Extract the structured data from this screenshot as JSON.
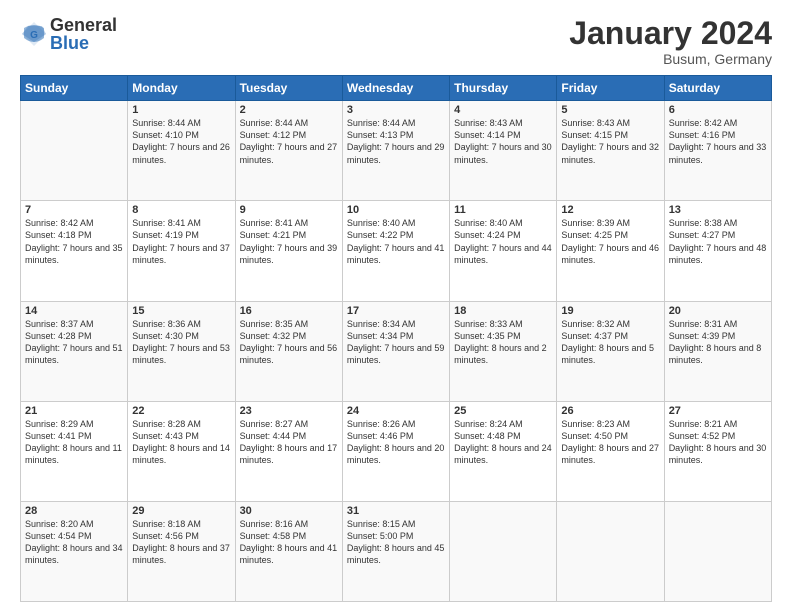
{
  "logo": {
    "general": "General",
    "blue": "Blue"
  },
  "header": {
    "month": "January 2024",
    "location": "Busum, Germany"
  },
  "weekdays": [
    "Sunday",
    "Monday",
    "Tuesday",
    "Wednesday",
    "Thursday",
    "Friday",
    "Saturday"
  ],
  "weeks": [
    [
      {
        "day": "",
        "sunrise": "",
        "sunset": "",
        "daylight": ""
      },
      {
        "day": "1",
        "sunrise": "Sunrise: 8:44 AM",
        "sunset": "Sunset: 4:10 PM",
        "daylight": "Daylight: 7 hours and 26 minutes."
      },
      {
        "day": "2",
        "sunrise": "Sunrise: 8:44 AM",
        "sunset": "Sunset: 4:12 PM",
        "daylight": "Daylight: 7 hours and 27 minutes."
      },
      {
        "day": "3",
        "sunrise": "Sunrise: 8:44 AM",
        "sunset": "Sunset: 4:13 PM",
        "daylight": "Daylight: 7 hours and 29 minutes."
      },
      {
        "day": "4",
        "sunrise": "Sunrise: 8:43 AM",
        "sunset": "Sunset: 4:14 PM",
        "daylight": "Daylight: 7 hours and 30 minutes."
      },
      {
        "day": "5",
        "sunrise": "Sunrise: 8:43 AM",
        "sunset": "Sunset: 4:15 PM",
        "daylight": "Daylight: 7 hours and 32 minutes."
      },
      {
        "day": "6",
        "sunrise": "Sunrise: 8:42 AM",
        "sunset": "Sunset: 4:16 PM",
        "daylight": "Daylight: 7 hours and 33 minutes."
      }
    ],
    [
      {
        "day": "7",
        "sunrise": "Sunrise: 8:42 AM",
        "sunset": "Sunset: 4:18 PM",
        "daylight": "Daylight: 7 hours and 35 minutes."
      },
      {
        "day": "8",
        "sunrise": "Sunrise: 8:41 AM",
        "sunset": "Sunset: 4:19 PM",
        "daylight": "Daylight: 7 hours and 37 minutes."
      },
      {
        "day": "9",
        "sunrise": "Sunrise: 8:41 AM",
        "sunset": "Sunset: 4:21 PM",
        "daylight": "Daylight: 7 hours and 39 minutes."
      },
      {
        "day": "10",
        "sunrise": "Sunrise: 8:40 AM",
        "sunset": "Sunset: 4:22 PM",
        "daylight": "Daylight: 7 hours and 41 minutes."
      },
      {
        "day": "11",
        "sunrise": "Sunrise: 8:40 AM",
        "sunset": "Sunset: 4:24 PM",
        "daylight": "Daylight: 7 hours and 44 minutes."
      },
      {
        "day": "12",
        "sunrise": "Sunrise: 8:39 AM",
        "sunset": "Sunset: 4:25 PM",
        "daylight": "Daylight: 7 hours and 46 minutes."
      },
      {
        "day": "13",
        "sunrise": "Sunrise: 8:38 AM",
        "sunset": "Sunset: 4:27 PM",
        "daylight": "Daylight: 7 hours and 48 minutes."
      }
    ],
    [
      {
        "day": "14",
        "sunrise": "Sunrise: 8:37 AM",
        "sunset": "Sunset: 4:28 PM",
        "daylight": "Daylight: 7 hours and 51 minutes."
      },
      {
        "day": "15",
        "sunrise": "Sunrise: 8:36 AM",
        "sunset": "Sunset: 4:30 PM",
        "daylight": "Daylight: 7 hours and 53 minutes."
      },
      {
        "day": "16",
        "sunrise": "Sunrise: 8:35 AM",
        "sunset": "Sunset: 4:32 PM",
        "daylight": "Daylight: 7 hours and 56 minutes."
      },
      {
        "day": "17",
        "sunrise": "Sunrise: 8:34 AM",
        "sunset": "Sunset: 4:34 PM",
        "daylight": "Daylight: 7 hours and 59 minutes."
      },
      {
        "day": "18",
        "sunrise": "Sunrise: 8:33 AM",
        "sunset": "Sunset: 4:35 PM",
        "daylight": "Daylight: 8 hours and 2 minutes."
      },
      {
        "day": "19",
        "sunrise": "Sunrise: 8:32 AM",
        "sunset": "Sunset: 4:37 PM",
        "daylight": "Daylight: 8 hours and 5 minutes."
      },
      {
        "day": "20",
        "sunrise": "Sunrise: 8:31 AM",
        "sunset": "Sunset: 4:39 PM",
        "daylight": "Daylight: 8 hours and 8 minutes."
      }
    ],
    [
      {
        "day": "21",
        "sunrise": "Sunrise: 8:29 AM",
        "sunset": "Sunset: 4:41 PM",
        "daylight": "Daylight: 8 hours and 11 minutes."
      },
      {
        "day": "22",
        "sunrise": "Sunrise: 8:28 AM",
        "sunset": "Sunset: 4:43 PM",
        "daylight": "Daylight: 8 hours and 14 minutes."
      },
      {
        "day": "23",
        "sunrise": "Sunrise: 8:27 AM",
        "sunset": "Sunset: 4:44 PM",
        "daylight": "Daylight: 8 hours and 17 minutes."
      },
      {
        "day": "24",
        "sunrise": "Sunrise: 8:26 AM",
        "sunset": "Sunset: 4:46 PM",
        "daylight": "Daylight: 8 hours and 20 minutes."
      },
      {
        "day": "25",
        "sunrise": "Sunrise: 8:24 AM",
        "sunset": "Sunset: 4:48 PM",
        "daylight": "Daylight: 8 hours and 24 minutes."
      },
      {
        "day": "26",
        "sunrise": "Sunrise: 8:23 AM",
        "sunset": "Sunset: 4:50 PM",
        "daylight": "Daylight: 8 hours and 27 minutes."
      },
      {
        "day": "27",
        "sunrise": "Sunrise: 8:21 AM",
        "sunset": "Sunset: 4:52 PM",
        "daylight": "Daylight: 8 hours and 30 minutes."
      }
    ],
    [
      {
        "day": "28",
        "sunrise": "Sunrise: 8:20 AM",
        "sunset": "Sunset: 4:54 PM",
        "daylight": "Daylight: 8 hours and 34 minutes."
      },
      {
        "day": "29",
        "sunrise": "Sunrise: 8:18 AM",
        "sunset": "Sunset: 4:56 PM",
        "daylight": "Daylight: 8 hours and 37 minutes."
      },
      {
        "day": "30",
        "sunrise": "Sunrise: 8:16 AM",
        "sunset": "Sunset: 4:58 PM",
        "daylight": "Daylight: 8 hours and 41 minutes."
      },
      {
        "day": "31",
        "sunrise": "Sunrise: 8:15 AM",
        "sunset": "Sunset: 5:00 PM",
        "daylight": "Daylight: 8 hours and 45 minutes."
      },
      {
        "day": "",
        "sunrise": "",
        "sunset": "",
        "daylight": ""
      },
      {
        "day": "",
        "sunrise": "",
        "sunset": "",
        "daylight": ""
      },
      {
        "day": "",
        "sunrise": "",
        "sunset": "",
        "daylight": ""
      }
    ]
  ]
}
